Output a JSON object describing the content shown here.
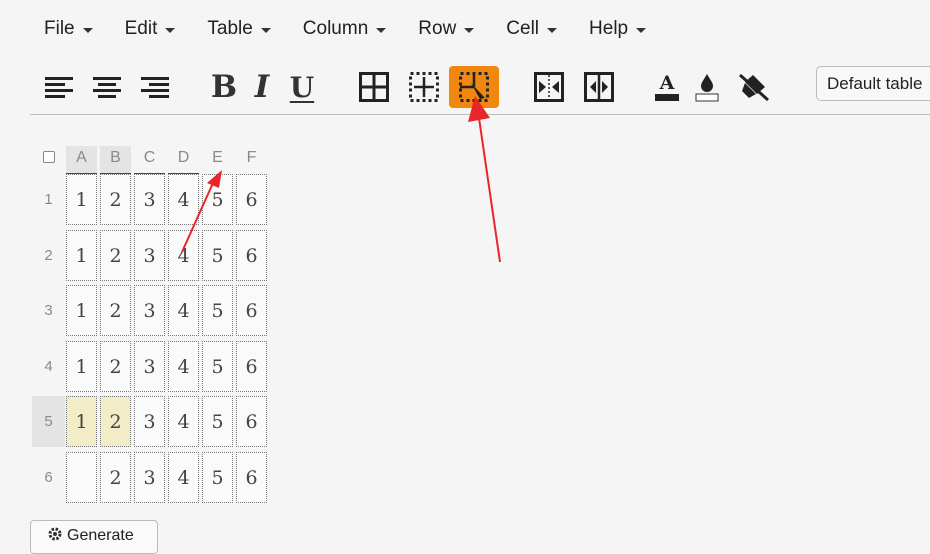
{
  "menubar": {
    "items": [
      {
        "label": "File"
      },
      {
        "label": "Edit"
      },
      {
        "label": "Table"
      },
      {
        "label": "Column"
      },
      {
        "label": "Row"
      },
      {
        "label": "Cell"
      },
      {
        "label": "Help"
      }
    ]
  },
  "toolbar": {
    "bold_label": "B",
    "italic_label": "I",
    "underline_label": "U",
    "table_style_select": "Default table",
    "active_color": "#f0870e",
    "icons": [
      "align-left-icon",
      "align-center-icon",
      "align-right-icon",
      "bold-icon",
      "italic-icon",
      "underline-icon",
      "all-borders-icon",
      "inner-borders-icon",
      "select-cells-icon",
      "merge-cells-icon",
      "split-cells-icon",
      "text-color-icon",
      "fill-color-icon",
      "clear-format-icon"
    ]
  },
  "table": {
    "columns": [
      "A",
      "B",
      "C",
      "D",
      "E",
      "F"
    ],
    "selected_columns": [
      "A",
      "B"
    ],
    "rows": [
      {
        "label": "1",
        "cells": [
          "1",
          "2",
          "3",
          "4",
          "5",
          "6"
        ]
      },
      {
        "label": "2",
        "cells": [
          "1",
          "2",
          "3",
          "4",
          "5",
          "6"
        ]
      },
      {
        "label": "3",
        "cells": [
          "1",
          "2",
          "3",
          "4",
          "5",
          "6"
        ]
      },
      {
        "label": "4",
        "cells": [
          "1",
          "2",
          "3",
          "4",
          "5",
          "6"
        ]
      },
      {
        "label": "5",
        "cells": [
          "1",
          "2",
          "3",
          "4",
          "5",
          "6"
        ]
      },
      {
        "label": "6",
        "cells": [
          "",
          "2",
          "3",
          "4",
          "5",
          "6"
        ]
      }
    ],
    "selected_row": "5",
    "highlight_color": "#f2edc6"
  },
  "generate_label": "Generate"
}
